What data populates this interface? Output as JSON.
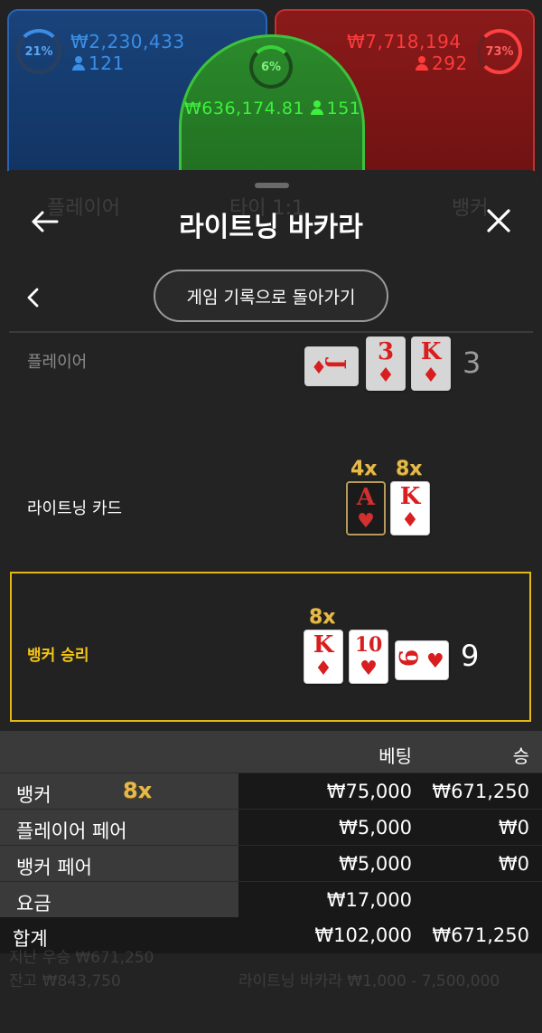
{
  "board": {
    "player": {
      "percent": "21%",
      "amount": "₩2,230,433",
      "count": "121",
      "color": "#3a8ee6"
    },
    "tie": {
      "percent": "6%",
      "amount": "₩636,174.81",
      "count": "151",
      "color": "#3ef03e"
    },
    "banker": {
      "percent": "73%",
      "amount": "₩7,718,194",
      "count": "292",
      "color": "#ff3a3a"
    },
    "ghost_player_label": "플레이어",
    "ghost_tie_label": "타이 1:1",
    "ghost_banker_label": "뱅커"
  },
  "header": {
    "title": "라이트닝 바카라",
    "back_icon": "arrow-left-icon",
    "close_icon": "close-icon"
  },
  "history_nav": {
    "return_button": "게임 기록으로 돌아가기",
    "chevron_icon": "chevron-left-icon"
  },
  "result": {
    "player": {
      "label": "플레이어",
      "score": "3",
      "cards": [
        {
          "rank": "J",
          "suit": "♦",
          "orientation": "sideways"
        },
        {
          "rank": "3",
          "suit": "♦"
        },
        {
          "rank": "K",
          "suit": "♦"
        }
      ]
    },
    "lightning": {
      "label": "라이트닝 카드",
      "cards": [
        {
          "rank": "A",
          "suit": "♥",
          "multiplier": "4x",
          "style": "dark"
        },
        {
          "rank": "K",
          "suit": "♦",
          "multiplier": "8x"
        }
      ]
    },
    "banker": {
      "label": "뱅커 승리",
      "score": "9",
      "cards": [
        {
          "rank": "K",
          "suit": "♦",
          "multiplier": "8x"
        },
        {
          "rank": "10",
          "suit": "♥"
        },
        {
          "rank": "9",
          "suit": "♥",
          "orientation": "sideways"
        }
      ]
    }
  },
  "bets": {
    "col_bet": "베팅",
    "col_win": "승",
    "rows": [
      {
        "name": "뱅커",
        "multiplier": "8x",
        "bet": "₩75,000",
        "win": "₩671,250"
      },
      {
        "name": "플레이어 페어",
        "bet": "₩5,000",
        "win": "₩0"
      },
      {
        "name": "뱅커 페어",
        "bet": "₩5,000",
        "win": "₩0"
      },
      {
        "name": "요금",
        "bet": "₩17,000",
        "win": ""
      }
    ],
    "total": {
      "name": "합계",
      "bet": "₩102,000",
      "win": "₩671,250"
    }
  },
  "footer_ghost": {
    "last_win": "지난 우승 ₩671,250",
    "balance": "잔고 ₩843,750",
    "table_limits": "라이트닝 바카라 ₩1,000 - 7,500,000"
  }
}
